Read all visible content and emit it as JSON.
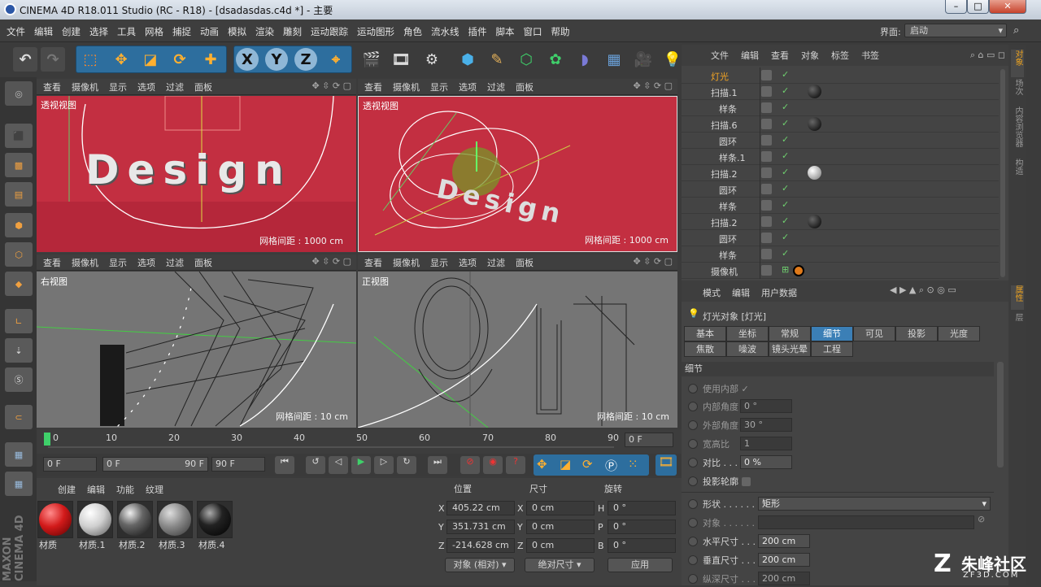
{
  "window": {
    "title": "CINEMA 4D R18.011 Studio (RC - R18) - [dsadasdas.c4d *] - 主要",
    "min": "–",
    "max": "□",
    "close": "✕"
  },
  "menu": [
    "文件",
    "编辑",
    "创建",
    "选择",
    "工具",
    "网格",
    "捕捉",
    "动画",
    "模拟",
    "渲染",
    "雕刻",
    "运动跟踪",
    "运动图形",
    "角色",
    "流水线",
    "插件",
    "脚本",
    "窗口",
    "帮助"
  ],
  "layout": {
    "label": "界面:",
    "value": "启动"
  },
  "toolbar": {
    "x": "X",
    "y": "Y",
    "z": "Z"
  },
  "viewport_menu": [
    "查看",
    "摄像机",
    "显示",
    "选项",
    "过滤",
    "面板"
  ],
  "viewports": [
    {
      "label": "透视视图",
      "grid": "网格间距 : 1000 cm"
    },
    {
      "label": "透视视图",
      "grid": "网格间距 : 1000 cm"
    },
    {
      "label": "右视图",
      "grid": "网格间距 : 10 cm"
    },
    {
      "label": "正视图",
      "grid": "网格间距 : 10 cm"
    }
  ],
  "scene_text": "Design",
  "objects": {
    "menu": [
      "文件",
      "编辑",
      "查看",
      "对象",
      "标签",
      "书签"
    ],
    "rows": [
      "灯光",
      "扫描.1",
      "样条",
      "扫描.6",
      "圆环",
      "样条.1",
      "扫描.2",
      "圆环",
      "样条",
      "扫描.2",
      "圆环",
      "样条",
      "摄像机"
    ]
  },
  "right_tabs": [
    "对象",
    "场次",
    "内容浏览器",
    "构造",
    "属性",
    "层"
  ],
  "attributes": {
    "menu": [
      "模式",
      "编辑",
      "用户数据"
    ],
    "title": "灯光对象 [灯光]",
    "tabs_row1": [
      "基本",
      "坐标",
      "常规",
      "细节",
      "可见",
      "投影",
      "光度"
    ],
    "tabs_row2": [
      "焦散",
      "噪波",
      "镜头光晕",
      "工程"
    ],
    "active_tab": "细节",
    "section": "细节",
    "fields": [
      {
        "label": "使用内部",
        "value": "✓"
      },
      {
        "label": "内部角度",
        "value": "0 °"
      },
      {
        "label": "外部角度",
        "value": "30 °"
      },
      {
        "label": "宽高比",
        "value": "1"
      },
      {
        "label": "对比 . . .",
        "value": "0 %"
      },
      {
        "label": "投影轮廓",
        "value": ""
      },
      {
        "label": "形状 . . . . . . .",
        "value": "矩形"
      },
      {
        "label": "对象 . . . . . . .",
        "value": ""
      },
      {
        "label": "水平尺寸 . . . .",
        "value": "200 cm"
      },
      {
        "label": "垂直尺寸 . . . .",
        "value": "200 cm"
      },
      {
        "label": "纵深尺寸 . . . .",
        "value": "200 cm"
      }
    ]
  },
  "timeline": {
    "ticks": [
      "0",
      "10",
      "20",
      "30",
      "40",
      "50",
      "60",
      "70",
      "80",
      "90"
    ],
    "frame": "0 F",
    "start": "0 F",
    "range_lo": "0 F",
    "range_hi": "90 F",
    "end": "90 F"
  },
  "materials": {
    "menu": [
      "创建",
      "编辑",
      "功能",
      "纹理"
    ],
    "items": [
      "材质",
      "材质.1",
      "材质.2",
      "材质.3",
      "材质.4"
    ]
  },
  "coordinates": {
    "headers": [
      "位置",
      "尺寸",
      "旋转"
    ],
    "pos": [
      {
        "axis": "X",
        "value": "405.22 cm"
      },
      {
        "axis": "Y",
        "value": "351.731 cm"
      },
      {
        "axis": "Z",
        "value": "-214.628 cm"
      }
    ],
    "size": [
      {
        "axis": "X",
        "value": "0 cm"
      },
      {
        "axis": "Y",
        "value": "0 cm"
      },
      {
        "axis": "Z",
        "value": "0 cm"
      }
    ],
    "rot": [
      {
        "axis": "H",
        "value": "0 °"
      },
      {
        "axis": "P",
        "value": "0 °"
      },
      {
        "axis": "B",
        "value": "0 °"
      }
    ],
    "mode": "对象 (相对)",
    "size_mode": "绝对尺寸",
    "apply": "应用"
  },
  "watermark": {
    "main": "朱峰社区",
    "sub": "ZF3D.COM"
  },
  "brand": "MAXON CINEMA 4D"
}
